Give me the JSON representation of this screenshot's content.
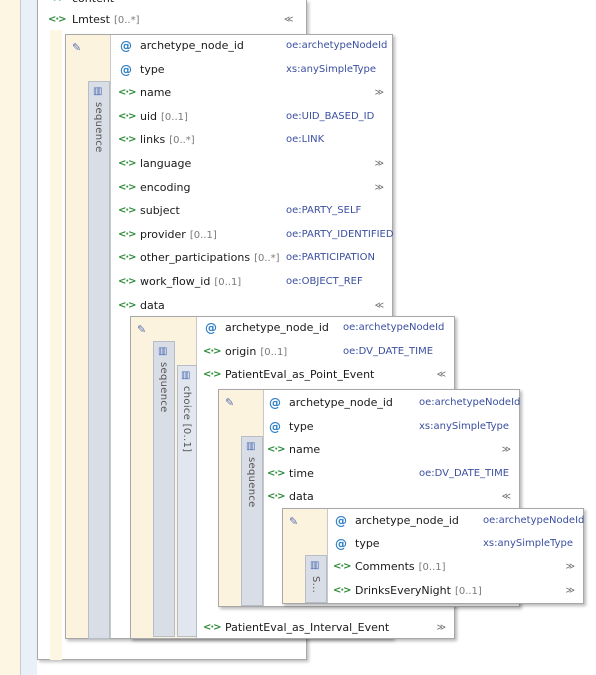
{
  "top": {
    "partial_label": "content",
    "lmtest": {
      "name": "Lmtest",
      "card": "[0..*]"
    }
  },
  "box1": {
    "sequence_label": "sequence",
    "rows": [
      {
        "kind": "attr",
        "name": "archetype_node_id",
        "card": "",
        "type": "oe:archetypeNodeId",
        "chev": ""
      },
      {
        "kind": "attr",
        "name": "type",
        "card": "",
        "type": "xs:anySimpleType",
        "chev": ""
      },
      {
        "kind": "elem",
        "name": "name",
        "card": "",
        "type": "",
        "chev": "≫"
      },
      {
        "kind": "elem",
        "name": "uid",
        "card": "[0..1]",
        "type": "oe:UID_BASED_ID",
        "chev": ""
      },
      {
        "kind": "elem",
        "name": "links",
        "card": "[0..*]",
        "type": "oe:LINK",
        "chev": ""
      },
      {
        "kind": "elem",
        "name": "language",
        "card": "",
        "type": "",
        "chev": "≫"
      },
      {
        "kind": "elem",
        "name": "encoding",
        "card": "",
        "type": "",
        "chev": "≫"
      },
      {
        "kind": "elem",
        "name": "subject",
        "card": "",
        "type": "oe:PARTY_SELF",
        "chev": ""
      },
      {
        "kind": "elem",
        "name": "provider",
        "card": "[0..1]",
        "type": "oe:PARTY_IDENTIFIED",
        "chev": ""
      },
      {
        "kind": "elem",
        "name": "other_participations",
        "card": "[0..*]",
        "type": "oe:PARTICIPATION",
        "chev": ""
      },
      {
        "kind": "elem",
        "name": "work_flow_id",
        "card": "[0..1]",
        "type": "oe:OBJECT_REF",
        "chev": ""
      },
      {
        "kind": "elem",
        "name": "data",
        "card": "",
        "type": "",
        "chev": "≪"
      }
    ]
  },
  "box2": {
    "sequence_label": "sequence",
    "choice_label": "choice",
    "choice_card": "[0..1]",
    "rows": [
      {
        "kind": "attr",
        "name": "archetype_node_id",
        "card": "",
        "type": "oe:archetypeNodeId",
        "chev": ""
      },
      {
        "kind": "elem",
        "name": "origin",
        "card": "[0..1]",
        "type": "oe:DV_DATE_TIME",
        "chev": ""
      },
      {
        "kind": "elem",
        "name": "PatientEval_as_Point_Event",
        "card": "",
        "type": "",
        "chev": "≪"
      }
    ],
    "bottom_row": {
      "kind": "elem",
      "name": "PatientEval_as_Interval_Event",
      "card": "",
      "type": "",
      "chev": "≫"
    }
  },
  "box3": {
    "sequence_label": "sequence",
    "rows": [
      {
        "kind": "attr",
        "name": "archetype_node_id",
        "card": "",
        "type": "oe:archetypeNodeId",
        "chev": ""
      },
      {
        "kind": "attr",
        "name": "type",
        "card": "",
        "type": "xs:anySimpleType",
        "chev": ""
      },
      {
        "kind": "elem",
        "name": "name",
        "card": "",
        "type": "",
        "chev": "≫"
      },
      {
        "kind": "elem",
        "name": "time",
        "card": "",
        "type": "oe:DV_DATE_TIME",
        "chev": ""
      },
      {
        "kind": "elem",
        "name": "data",
        "card": "",
        "type": "",
        "chev": "≪"
      }
    ]
  },
  "box4": {
    "sequence_label": "S...",
    "rows": [
      {
        "kind": "attr",
        "name": "archetype_node_id",
        "card": "",
        "type": "oe:archetypeNodeId",
        "chev": ""
      },
      {
        "kind": "attr",
        "name": "type",
        "card": "",
        "type": "xs:anySimpleType",
        "chev": ""
      },
      {
        "kind": "elem",
        "name": "Comments",
        "card": "[0..1]",
        "type": "",
        "chev": "≫"
      },
      {
        "kind": "elem",
        "name": "DrinksEveryNight",
        "card": "[0..1]",
        "type": "",
        "chev": "≫"
      }
    ]
  },
  "icons": {
    "attr": "@",
    "elem": "<·>",
    "model": "✎"
  }
}
